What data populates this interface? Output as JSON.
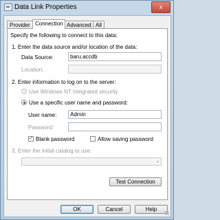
{
  "window": {
    "title": "Data Link Properties",
    "close_glyph": "x"
  },
  "tabs": [
    {
      "label": "Provider"
    },
    {
      "label": "Connection"
    },
    {
      "label": "Advanced"
    },
    {
      "label": "All"
    }
  ],
  "intro": "Specify the following to connect to this data:",
  "step1": {
    "heading": "1. Enter the data source and/or location of the data:",
    "data_source_label": "Data Source:",
    "data_source_value": "baru.accdb",
    "location_label": "Location:",
    "location_value": ""
  },
  "step2": {
    "heading": "2. Enter information to log on to the server:",
    "radio_nt": "Use Windows NT Integrated security",
    "radio_specific": "Use a specific user name and password:",
    "username_label": "User name:",
    "username_value": "Admin",
    "password_label": "Password:",
    "password_value": "",
    "blank_password_label": "Blank password",
    "blank_password_checked": true,
    "allow_saving_label": "Allow saving password",
    "allow_saving_checked": false
  },
  "step3": {
    "heading": "3. Enter the initial catalog to use:",
    "catalog_value": ""
  },
  "test_button": "Test Connection",
  "footer": {
    "ok": "OK",
    "cancel": "Cancel",
    "help": "Help"
  },
  "check_glyph": "✓",
  "arrow_glyph": "▾"
}
